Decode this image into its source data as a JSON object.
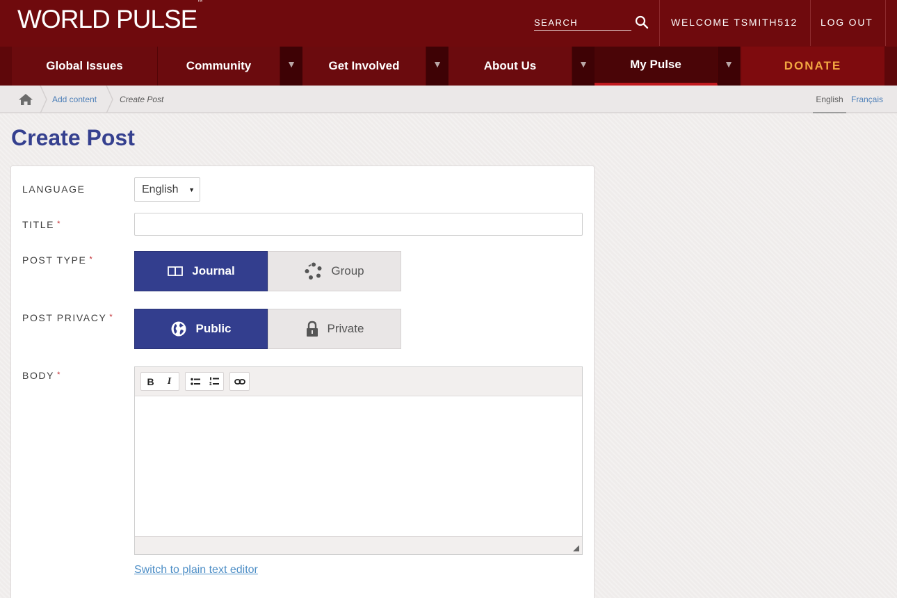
{
  "header": {
    "logo_text": "WORLD PULSE",
    "logo_mark": "™",
    "search_placeholder": "SEARCH",
    "welcome": "WELCOME TSMITH512",
    "logout": "LOG OUT"
  },
  "nav": {
    "items": [
      {
        "label": "Global Issues"
      },
      {
        "label": "Community"
      },
      {
        "label": "Get Involved"
      },
      {
        "label": "About Us"
      },
      {
        "label": "My Pulse"
      }
    ],
    "caret": "▼",
    "donate": "DONATE"
  },
  "breadcrumb": {
    "link": "Add content",
    "current": "Create Post"
  },
  "languages": {
    "english": "English",
    "french": "Français"
  },
  "page": {
    "title": "Create Post"
  },
  "form": {
    "required_mark": "*",
    "language": {
      "label": "LANGUAGE",
      "value": "English",
      "arrow": "▼"
    },
    "title": {
      "label": "TITLE",
      "value": ""
    },
    "post_type": {
      "label": "POST TYPE",
      "options": [
        {
          "label": "Journal",
          "icon": "book-icon",
          "selected": true
        },
        {
          "label": "Group",
          "icon": "group-icon",
          "selected": false
        }
      ]
    },
    "post_privacy": {
      "label": "POST PRIVACY",
      "options": [
        {
          "label": "Public",
          "icon": "globe-icon",
          "selected": true
        },
        {
          "label": "Private",
          "icon": "lock-icon",
          "selected": false
        }
      ]
    },
    "body": {
      "label": "BODY",
      "toolbar": {
        "bold": "B",
        "italic": "I"
      },
      "switch_link": "Switch to plain text editor"
    }
  },
  "colors": {
    "header_bg": "#6f0a0d",
    "nav_bg": "#6b0b0e",
    "donate_text": "#f2a742",
    "title_blue": "#35408f",
    "selected_seg": "#333e8e",
    "link_blue": "#4d8ec6"
  }
}
